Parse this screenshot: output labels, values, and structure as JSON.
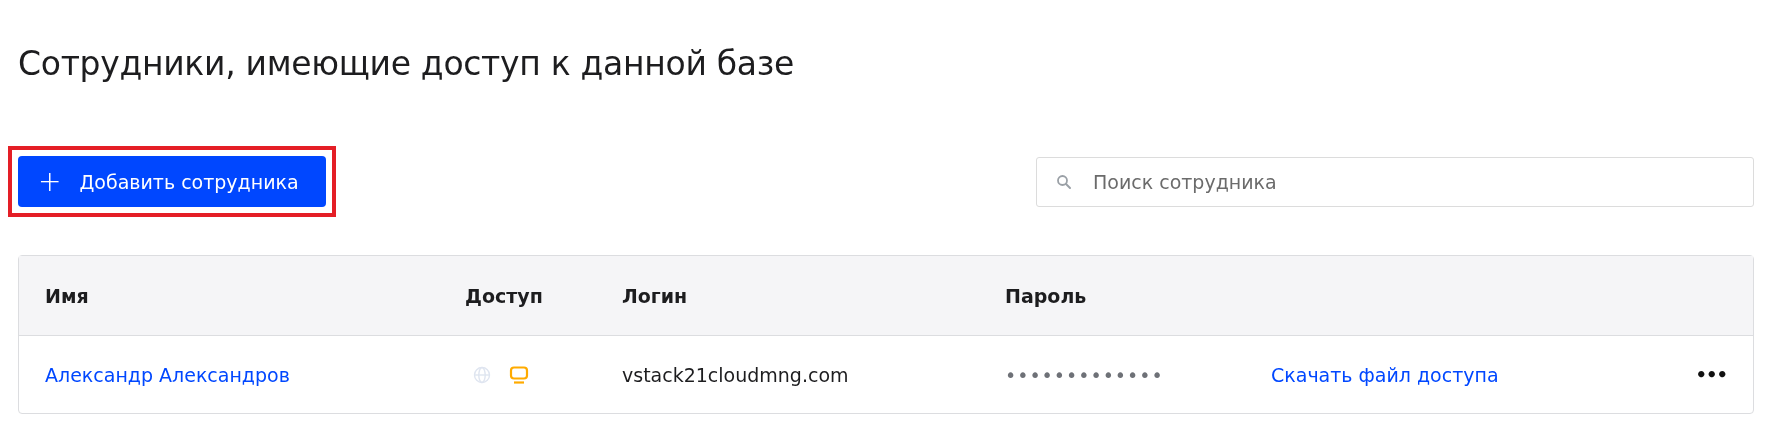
{
  "title": "Сотрудники, имеющие доступ к данной базе",
  "add_button": {
    "icon": "+",
    "label": "Добавить сотрудника",
    "highlighted": true
  },
  "search": {
    "placeholder": "Поиск сотрудника"
  },
  "table": {
    "columns": [
      "Имя",
      "Доступ",
      "Логин",
      "Пароль"
    ],
    "rows": [
      {
        "name": "Александр Александров",
        "web_access": false,
        "desktop_access": true,
        "login": "vstack21cloudmng.com",
        "password": "•••••••••••••",
        "download_link": "Скачать файл доступа",
        "menu": "•••"
      }
    ]
  }
}
